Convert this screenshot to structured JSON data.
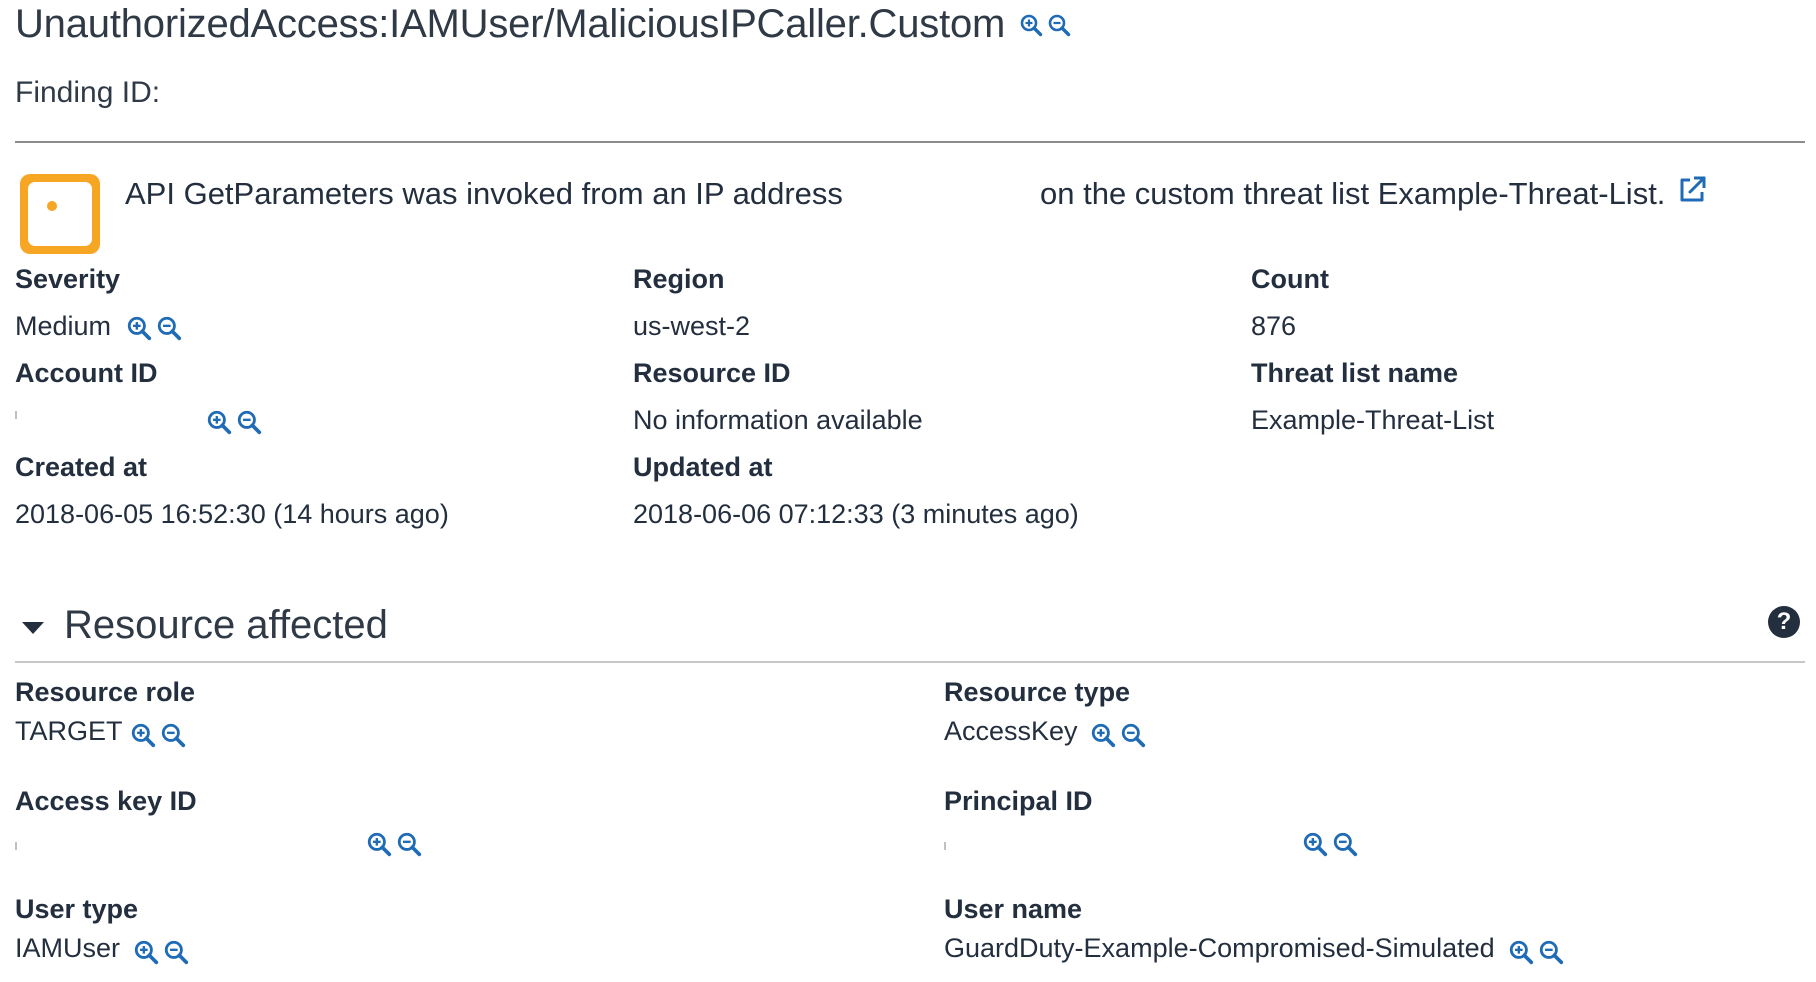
{
  "finding": {
    "title": "UnauthorizedAccess:IAMUser/MaliciousIPCaller.Custom",
    "finding_id_label": "Finding ID:",
    "summary_part1": "API GetParameters was invoked from an IP address",
    "summary_part2": "on the custom threat list Example-Threat-List.",
    "severity_level": "Medium",
    "severity_color": "#f6a623"
  },
  "fields": {
    "severity": {
      "label": "Severity",
      "value": "Medium"
    },
    "region": {
      "label": "Region",
      "value": "us-west-2"
    },
    "count": {
      "label": "Count",
      "value": "876"
    },
    "account_id": {
      "label": "Account ID",
      "value": ""
    },
    "resource_id": {
      "label": "Resource ID",
      "value": "No information available"
    },
    "threat_list_name": {
      "label": "Threat list name",
      "value": "Example-Threat-List"
    },
    "created_at": {
      "label": "Created at",
      "value": "2018-06-05 16:52:30 (14 hours ago)"
    },
    "updated_at": {
      "label": "Updated at",
      "value": "2018-06-06 07:12:33 (3 minutes ago)"
    }
  },
  "resource_affected": {
    "title": "Resource affected",
    "resource_role": {
      "label": "Resource role",
      "value": "TARGET"
    },
    "resource_type": {
      "label": "Resource type",
      "value": "AccessKey"
    },
    "access_key_id": {
      "label": "Access key ID",
      "value": ""
    },
    "principal_id": {
      "label": "Principal ID",
      "value": ""
    },
    "user_type": {
      "label": "User type",
      "value": "IAMUser"
    },
    "user_name": {
      "label": "User name",
      "value": "GuardDuty-Example-Compromised-Simulated"
    }
  },
  "icons": {
    "zoom_in": "zoom-in-icon",
    "zoom_out": "zoom-out-icon",
    "external_link": "external-link-icon",
    "help": "help-icon",
    "collapse": "caret-down-icon",
    "help_glyph": "?"
  },
  "colors": {
    "accent": "#1f6bb5",
    "text": "#232f3e",
    "warning": "#f6a623"
  }
}
